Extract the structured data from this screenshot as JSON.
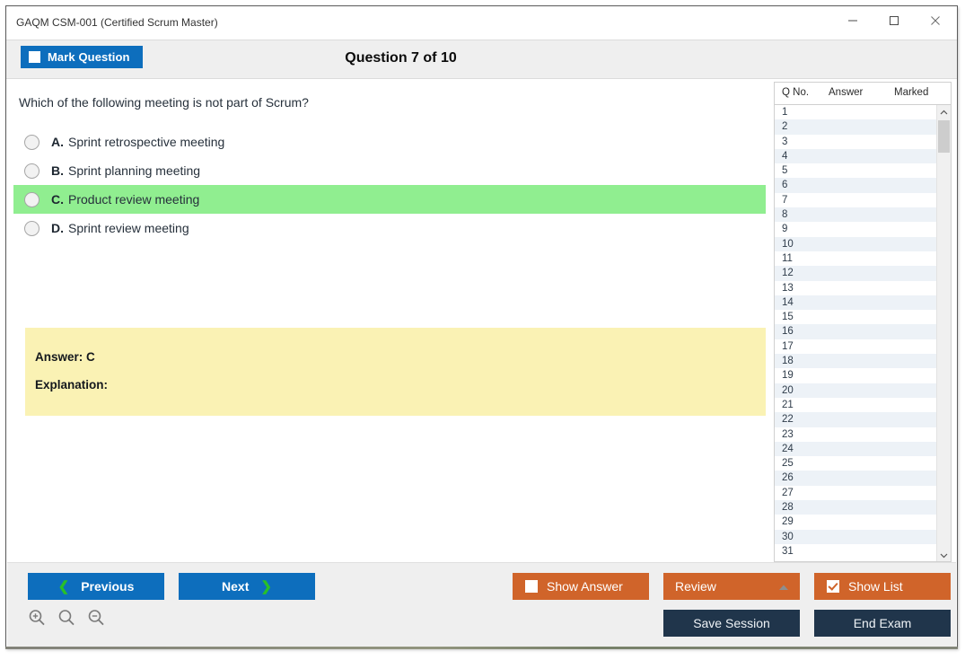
{
  "window": {
    "title": "GAQM CSM-001 (Certified Scrum Master)",
    "controls": {
      "minimize": "minimize-icon",
      "maximize": "maximize-icon",
      "close": "close-icon"
    }
  },
  "header": {
    "mark_question_label": "Mark Question",
    "mark_question_checked": false,
    "question_counter": "Question 7 of 10"
  },
  "question": {
    "text": "Which of the following meeting is not part of Scrum?",
    "options": [
      {
        "letter": "A.",
        "text": "Sprint retrospective meeting",
        "highlighted": false,
        "selected": false
      },
      {
        "letter": "B.",
        "text": "Sprint planning meeting",
        "highlighted": false,
        "selected": false
      },
      {
        "letter": "C.",
        "text": "Product review meeting",
        "highlighted": true,
        "selected": false
      },
      {
        "letter": "D.",
        "text": "Sprint review meeting",
        "highlighted": false,
        "selected": false
      }
    ],
    "answer_label": "Answer: C",
    "explanation_label": "Explanation:",
    "answer_box_color": "#faf2b4",
    "highlight_color": "#90ee90"
  },
  "list_panel": {
    "columns": [
      "Q No.",
      "Answer",
      "Marked"
    ],
    "rows": [
      {
        "qno": "1",
        "answer": "",
        "marked": ""
      },
      {
        "qno": "2",
        "answer": "",
        "marked": ""
      },
      {
        "qno": "3",
        "answer": "",
        "marked": ""
      },
      {
        "qno": "4",
        "answer": "",
        "marked": ""
      },
      {
        "qno": "5",
        "answer": "",
        "marked": ""
      },
      {
        "qno": "6",
        "answer": "",
        "marked": ""
      },
      {
        "qno": "7",
        "answer": "",
        "marked": ""
      },
      {
        "qno": "8",
        "answer": "",
        "marked": ""
      },
      {
        "qno": "9",
        "answer": "",
        "marked": ""
      },
      {
        "qno": "10",
        "answer": "",
        "marked": ""
      },
      {
        "qno": "11",
        "answer": "",
        "marked": ""
      },
      {
        "qno": "12",
        "answer": "",
        "marked": ""
      },
      {
        "qno": "13",
        "answer": "",
        "marked": ""
      },
      {
        "qno": "14",
        "answer": "",
        "marked": ""
      },
      {
        "qno": "15",
        "answer": "",
        "marked": ""
      },
      {
        "qno": "16",
        "answer": "",
        "marked": ""
      },
      {
        "qno": "17",
        "answer": "",
        "marked": ""
      },
      {
        "qno": "18",
        "answer": "",
        "marked": ""
      },
      {
        "qno": "19",
        "answer": "",
        "marked": ""
      },
      {
        "qno": "20",
        "answer": "",
        "marked": ""
      },
      {
        "qno": "21",
        "answer": "",
        "marked": ""
      },
      {
        "qno": "22",
        "answer": "",
        "marked": ""
      },
      {
        "qno": "23",
        "answer": "",
        "marked": ""
      },
      {
        "qno": "24",
        "answer": "",
        "marked": ""
      },
      {
        "qno": "25",
        "answer": "",
        "marked": ""
      },
      {
        "qno": "26",
        "answer": "",
        "marked": ""
      },
      {
        "qno": "27",
        "answer": "",
        "marked": ""
      },
      {
        "qno": "28",
        "answer": "",
        "marked": ""
      },
      {
        "qno": "29",
        "answer": "",
        "marked": ""
      },
      {
        "qno": "30",
        "answer": "",
        "marked": ""
      },
      {
        "qno": "31",
        "answer": "",
        "marked": ""
      }
    ]
  },
  "footer": {
    "previous_label": "Previous",
    "next_label": "Next",
    "show_answer_label": "Show Answer",
    "show_answer_checked": false,
    "review_label": "Review",
    "show_list_label": "Show List",
    "show_list_checked": true,
    "save_session_label": "Save Session",
    "end_exam_label": "End Exam",
    "zoom_icons": [
      "zoom-in-icon",
      "zoom-reset-icon",
      "zoom-out-icon"
    ]
  },
  "colors": {
    "primary_blue": "#0d6ebd",
    "accent_orange": "#d0642a",
    "dark_navy": "#20354b",
    "chevron_green": "#28c028",
    "header_grey": "#efefef"
  }
}
